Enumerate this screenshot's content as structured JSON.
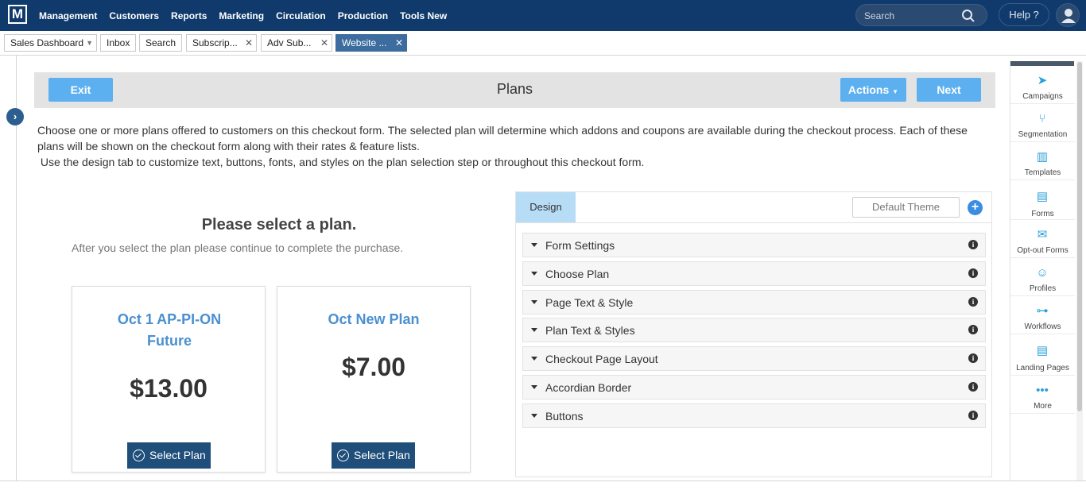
{
  "app": {
    "logo": "M"
  },
  "nav": [
    "Management",
    "Customers",
    "Reports",
    "Marketing",
    "Circulation",
    "Production",
    "Tools New"
  ],
  "search": {
    "placeholder": "Search"
  },
  "help_label": "Help ?",
  "tabs": [
    {
      "label": "Sales Dashboard",
      "control": "caret"
    },
    {
      "label": "Inbox"
    },
    {
      "label": "Search"
    },
    {
      "label": "Subscrip...",
      "control": "close"
    },
    {
      "label": "Adv Sub...",
      "control": "close"
    },
    {
      "label": "Website ...",
      "control": "close",
      "active": true
    }
  ],
  "header": {
    "title": "Plans",
    "exit": "Exit",
    "actions": "Actions",
    "next": "Next"
  },
  "intro": {
    "line1": "Choose one or more plans offered to customers on this checkout form. The selected plan will determine which addons and coupons are available during the checkout process. Each of these plans will be shown on the checkout form along with their rates & feature lists.",
    "line2": " Use the design tab to customize text, buttons, fonts, and styles on the plan selection step or throughout this checkout form."
  },
  "plans": {
    "heading": "Please select a plan.",
    "subheading": "After you select the plan please continue to complete the purchase.",
    "cards": [
      {
        "name": "Oct 1 AP-PI-ON Future",
        "price": "$13.00",
        "button": "Select Plan"
      },
      {
        "name": "Oct New Plan",
        "price": "$7.00",
        "button": "Select Plan"
      }
    ]
  },
  "design": {
    "tab": "Design",
    "theme_placeholder": "Default Theme",
    "sections": [
      "Form Settings",
      "Choose Plan",
      "Page Text & Style",
      "Plan Text & Styles",
      "Checkout Page Layout",
      "Accordian Border",
      "Buttons"
    ]
  },
  "sidebar": [
    {
      "label": "Campaigns",
      "icon": "paper-plane-icon"
    },
    {
      "label": "Segmentation",
      "icon": "segmentation-icon"
    },
    {
      "label": "Templates",
      "icon": "templates-icon"
    },
    {
      "label": "Forms",
      "icon": "forms-icon"
    },
    {
      "label": "Opt-out Forms",
      "icon": "optout-forms-icon"
    },
    {
      "label": "Profiles",
      "icon": "profiles-icon"
    },
    {
      "label": "Workflows",
      "icon": "workflows-icon"
    },
    {
      "label": "Landing Pages",
      "icon": "landing-pages-icon"
    },
    {
      "label": "More",
      "icon": "more-icon"
    }
  ],
  "colors": {
    "nav_bg": "#0f3a6b",
    "accent_blue": "#5cb0f0",
    "plan_title": "#4a90d0",
    "select_button": "#1f4e7a",
    "active_tab": "#3c6d9e"
  }
}
